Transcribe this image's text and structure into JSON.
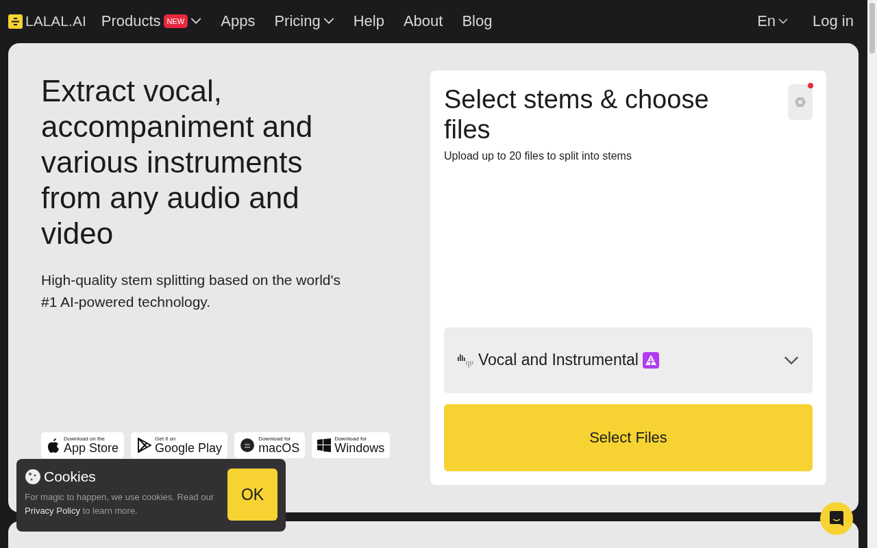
{
  "nav": {
    "logo": "LALAL.AI",
    "items": [
      {
        "label": "Products",
        "badge": "NEW",
        "caret": true
      },
      {
        "label": "Apps",
        "caret": false
      },
      {
        "label": "Pricing",
        "caret": true
      },
      {
        "label": "Help",
        "caret": false
      },
      {
        "label": "About",
        "caret": false
      },
      {
        "label": "Blog",
        "caret": false
      }
    ],
    "language": "En",
    "login": "Log in"
  },
  "hero": {
    "title": "Extract vocal, accompaniment and various instruments from any audio and video",
    "subtitle": "High-quality stem splitting based on the world's #1 AI-powered technology.",
    "stores": [
      {
        "kind": "apple",
        "small": "Download on the",
        "big": "App Store"
      },
      {
        "kind": "play",
        "small": "Get it on",
        "big": "Google Play"
      },
      {
        "kind": "mac",
        "small": "Download for",
        "big": "macOS"
      },
      {
        "kind": "windows",
        "small": "Download for",
        "big": "Windows"
      }
    ]
  },
  "upload": {
    "title": "Select stems & choose files",
    "subtitle": "Upload up to 20 files to split into stems",
    "settings_notification": true,
    "stem": "Vocal and Instrumental",
    "button": "Select Files"
  },
  "cookies": {
    "title": "Cookies",
    "text_before": "For magic to happen, we use cookies. Read our ",
    "link": "Privacy Policy",
    "text_after": " to learn more.",
    "button": "OK"
  }
}
